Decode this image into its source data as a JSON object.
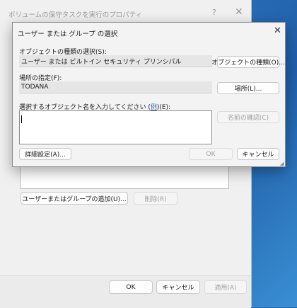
{
  "back_window": {
    "title": "ボリュームの保守タスクを実行のプロパティ",
    "help_glyph": "?",
    "close_glyph": "✕",
    "add_button": "ユーザーまたはグループの追加(U)...",
    "remove_button": "削除(R)",
    "ok_button": "OK",
    "cancel_button": "キャンセル",
    "apply_button": "適用(A)"
  },
  "dialog": {
    "title": "ユーザー または グループ の選択",
    "close_glyph": "✕",
    "object_type_label": "オブジェクトの種類の選択(S):",
    "object_type_value": "ユーザー または ビルトイン セキュリティ プリンシパル",
    "object_type_button": "オブジェクトの種類(O)...",
    "location_label": "場所の指定(F):",
    "location_value": "TODANA",
    "location_button": "場所(L)...",
    "names_label_prefix": "選択するオブジェクト名を入力してください (",
    "names_label_example": "例",
    "names_label_suffix": ")(E):",
    "names_input_value": "",
    "check_names_button": "名前の確認(C)",
    "advanced_button": "詳細設定(A)...",
    "ok_button": "OK",
    "cancel_button": "キャンセル"
  }
}
